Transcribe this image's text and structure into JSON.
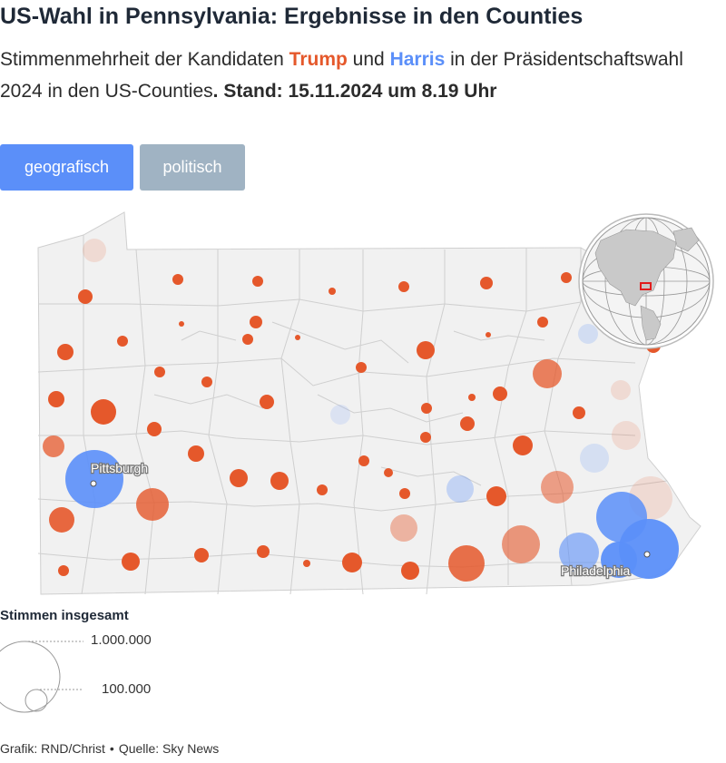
{
  "header": {
    "title": "US-Wahl in Pennsylvania: Ergebnisse in den Counties",
    "subtitle_pre": "Stimmenmehrheit der Kandidaten ",
    "trump": "Trump",
    "mid": " und ",
    "harris": "Harris",
    "subtitle_post": " in der Präsidentschaftswahl 2024 in den US-Counties",
    "stand": ". Stand: 15.11.2024 um 8.19 Uhr"
  },
  "toggle": {
    "geo_label": "geografisch",
    "pol_label": "politisch",
    "selected": "geografisch"
  },
  "colors": {
    "trump": "#e5582b",
    "harris": "#5b8ff9",
    "map_fill": "#f1f1f1",
    "border": "#cfcfcf"
  },
  "map": {
    "state": "Pennsylvania",
    "cities": [
      {
        "name": "Pittsburgh",
        "icon": "city-dot-icon"
      },
      {
        "name": "Philadelphia",
        "icon": "city-dot-icon"
      }
    ],
    "inset": {
      "icon": "globe-locator-icon"
    }
  },
  "legend": {
    "title": "Stimmen insgesamt",
    "large": "1.000.000",
    "small": "100.000"
  },
  "footer": {
    "grafik": "Grafik: RND/Christ",
    "bullet": "•",
    "quelle": "Quelle: Sky News"
  }
}
